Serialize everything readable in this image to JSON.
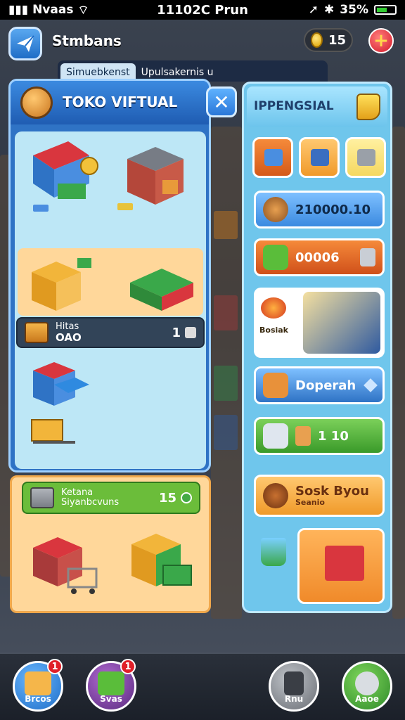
{
  "status_bar": {
    "carrier": "Nvaas",
    "time": "11102C Prun",
    "battery": "35%"
  },
  "header": {
    "title": "Stmbans",
    "coins": "15",
    "add_label": "+"
  },
  "tabs": [
    {
      "label": "Simuebkenst"
    },
    {
      "label": "Upulsakernis u"
    }
  ],
  "store_panel": {
    "title": "TOKO VIFTUAL",
    "close_label": "✕",
    "info_strip": {
      "label_top": "Hitas",
      "label_bottom": "OAO",
      "value": "1"
    }
  },
  "lower_panel": {
    "strip": {
      "label_top": "Ketana",
      "label_bottom": "Siyanbcvuns",
      "value": "15"
    }
  },
  "upgrade_panel": {
    "title": "IPPENGSIAL",
    "rows": [
      {
        "text": "210000.10"
      },
      {
        "text": "00006"
      },
      {
        "text": "Doperah"
      },
      {
        "text": "1 10"
      },
      {
        "text_top": "Sosk Byou",
        "text_bottom": "Seanio"
      }
    ],
    "special_card_label": "Bosiak"
  },
  "bottom_nav": [
    {
      "label": "Brcos",
      "badge": "1",
      "color": "#2f8be0"
    },
    {
      "label": "Svas",
      "badge": "1",
      "color": "#7a3b9e"
    },
    {
      "label": "Rnu",
      "badge": "",
      "color": "#8d8f94"
    },
    {
      "label": "Aaoe",
      "badge": "",
      "color": "#3eaa3a"
    }
  ],
  "colors": {
    "panel_blue": "#2f73c5",
    "panel_light": "#bde7f6",
    "accent_orange": "#f0a84c",
    "accent_green": "#6bbd3a",
    "badge_red": "#e01f28"
  }
}
